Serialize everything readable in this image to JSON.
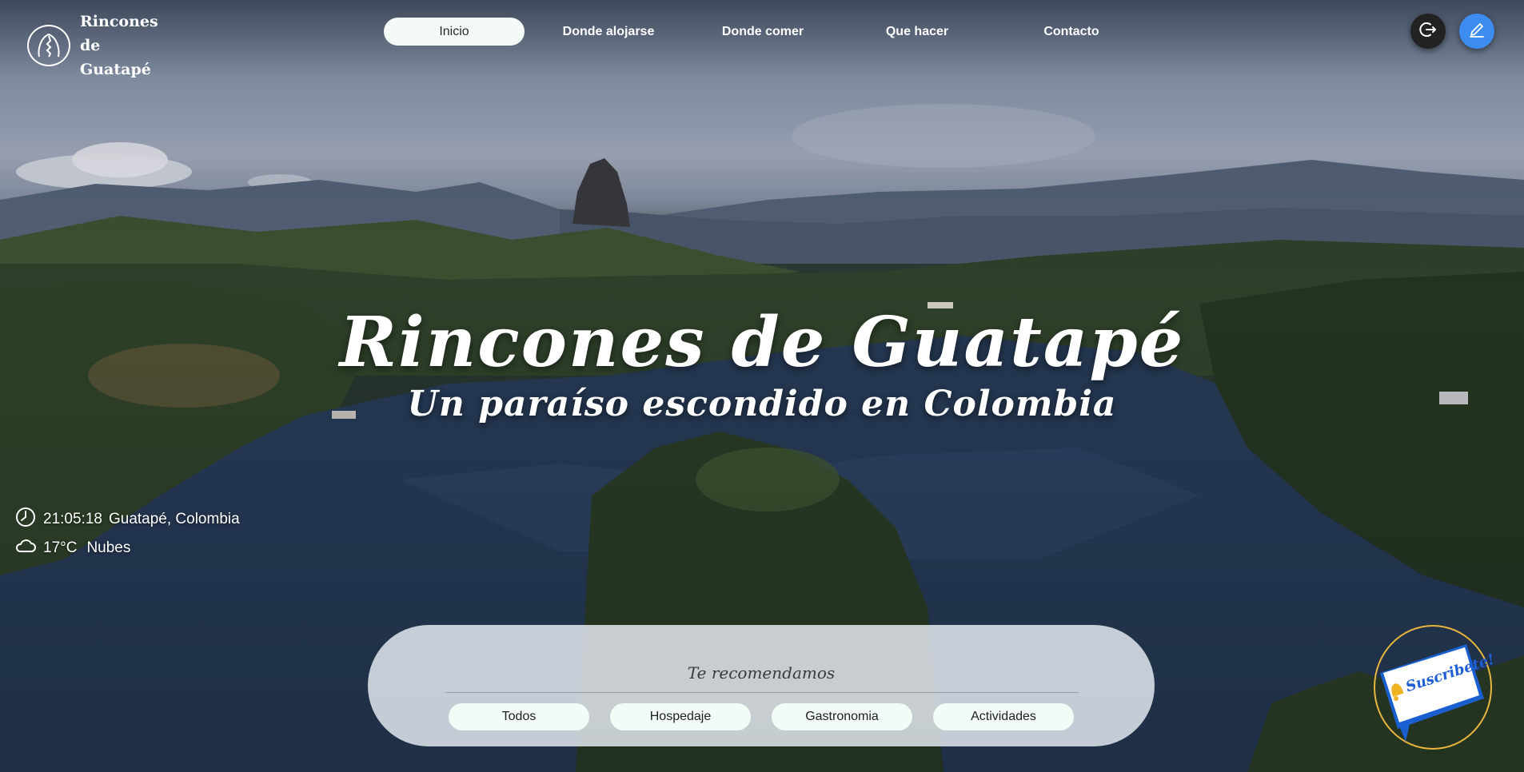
{
  "brand": {
    "name": "Rincones de Guatapé"
  },
  "nav": {
    "items": [
      {
        "label": "Inicio",
        "active": true
      },
      {
        "label": "Donde alojarse",
        "active": false
      },
      {
        "label": "Donde comer",
        "active": false
      },
      {
        "label": "Que hacer",
        "active": false
      },
      {
        "label": "Contacto",
        "active": false
      }
    ]
  },
  "actions": {
    "logout_icon": "logout-icon",
    "edit_icon": "pencil-icon"
  },
  "hero": {
    "title": "Rincones de Guatapé",
    "subtitle": "Un paraíso escondido en Colombia"
  },
  "info": {
    "time": "21:05:18",
    "location": "Guatapé, Colombia",
    "temperature": "17°C",
    "condition": "Nubes"
  },
  "recommend": {
    "title": "Te recomendamos",
    "filters": [
      "Todos",
      "Hospedaje",
      "Gastronomia",
      "Actividades"
    ]
  },
  "subscribe": {
    "label": "Suscribete!"
  },
  "colors": {
    "accent_blue": "#3d8cf0",
    "pill_bg": "#f4fbf7",
    "badge_ring": "#e8b53c"
  }
}
